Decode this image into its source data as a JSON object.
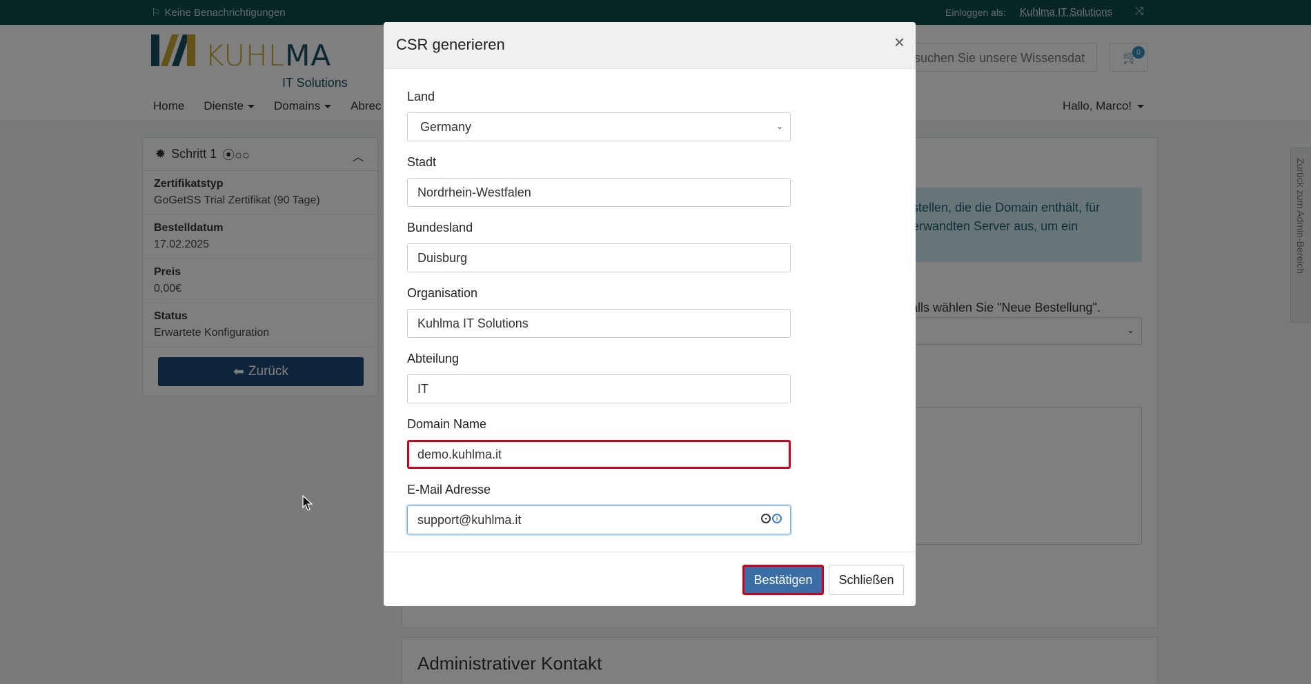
{
  "topbar": {
    "notifications": "Keine Benachrichtigungen",
    "login_label": "Einloggen als:",
    "login_user": "Kuhlma IT Solutions"
  },
  "header": {
    "logo_word_a": "KUHL",
    "logo_word_b": "MA",
    "logo_tag": "IT Solutions",
    "search_placeholder": "nsuchen Sie unsere Wissensdat",
    "cart_count": "0",
    "nav": [
      "Home",
      "Dienste",
      "Domains",
      "Abrec"
    ],
    "greeting": "Hallo, Marco!"
  },
  "sidebar": {
    "step_title": "Schritt 1",
    "rows": [
      {
        "label": "Zertifikatstyp",
        "value": "GoGetSS Trial Zertifikat (90 Tage)"
      },
      {
        "label": "Bestelldatum",
        "value": "17.02.2025"
      },
      {
        "label": "Preis",
        "value": "0,00€"
      },
      {
        "label": "Status",
        "value": "Erwartete Konfiguration"
      }
    ],
    "back_label": "Zurück"
  },
  "main": {
    "alert_text": "stellen, die die Domain enthält, für erwandten Server aus, um ein",
    "order_hint": "alls wählen Sie \"Neue Bestellung\".",
    "admin_title": "Administrativer Kontakt",
    "side_tab": "Zurück zum Admin-Bereich"
  },
  "modal": {
    "title": "CSR generieren",
    "fields": [
      {
        "label": "Land",
        "value": "Germany"
      },
      {
        "label": "Stadt",
        "value": "Nordrhein-Westfalen"
      },
      {
        "label": "Bundesland",
        "value": "Duisburg"
      },
      {
        "label": "Organisation",
        "value": "Kuhlma IT Solutions"
      },
      {
        "label": "Abteilung",
        "value": "IT"
      },
      {
        "label": "Domain Name",
        "value": "demo.kuhlma.it"
      },
      {
        "label": "E-Mail Adresse",
        "value": "support@kuhlma.it"
      }
    ],
    "confirm_label": "Bestätigen",
    "close_label": "Schließen"
  }
}
